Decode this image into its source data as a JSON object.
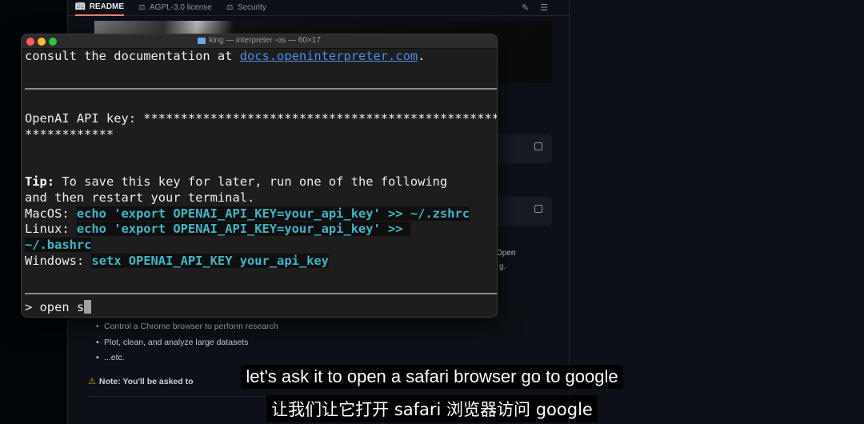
{
  "github": {
    "tabs": [
      {
        "label": "README",
        "icon": "book-icon",
        "active": true
      },
      {
        "label": "AGPL-3.0 license",
        "icon": "scale-icon",
        "active": false
      },
      {
        "label": "Security",
        "icon": "law-icon",
        "active": false
      }
    ],
    "snippets": {
      "open": "Open",
      "g": "g."
    },
    "list_items": [
      "Control a Chrome browser to perform research",
      "Plot, clean, and analyze large datasets",
      "...etc."
    ],
    "note": "Note: You'll be asked to"
  },
  "terminal": {
    "title": "king — interpreter -os — 60×17",
    "lines": {
      "docs_prefix": "consult the documentation at ",
      "docs_link": "docs.openinterpreter.com",
      "docs_suffix": ".",
      "api_key_line1": "OpenAI API key: ****************************************************",
      "api_key_line2": "************",
      "tip_label": "Tip:",
      "tip_text1": " To save this key for later, run one of the following",
      "tip_text2": "and then restart your terminal.",
      "macos_label": "MacOS: ",
      "macos_cmd": "echo 'export OPENAI_API_KEY=your_api_key' >> ~/.zshrc",
      "linux_label": "Linux: ",
      "linux_cmd1": "echo 'export OPENAI_API_KEY=your_api_key' >> ",
      "linux_cmd2": "~/.bashrc",
      "windows_label": "Windows: ",
      "windows_cmd": "setx OPENAI_API_KEY your_api_key",
      "prompt": "> open s"
    }
  },
  "subtitles": {
    "english": "let's ask it to open a safari browser go to google",
    "chinese": "让我们让它打开 safari 浏览器访问 google"
  },
  "colors": {
    "link": "#4d8ce6",
    "code": "#3ab7c8",
    "close": "#ff5f57",
    "minimize": "#febc2e",
    "maximize": "#28c840"
  }
}
